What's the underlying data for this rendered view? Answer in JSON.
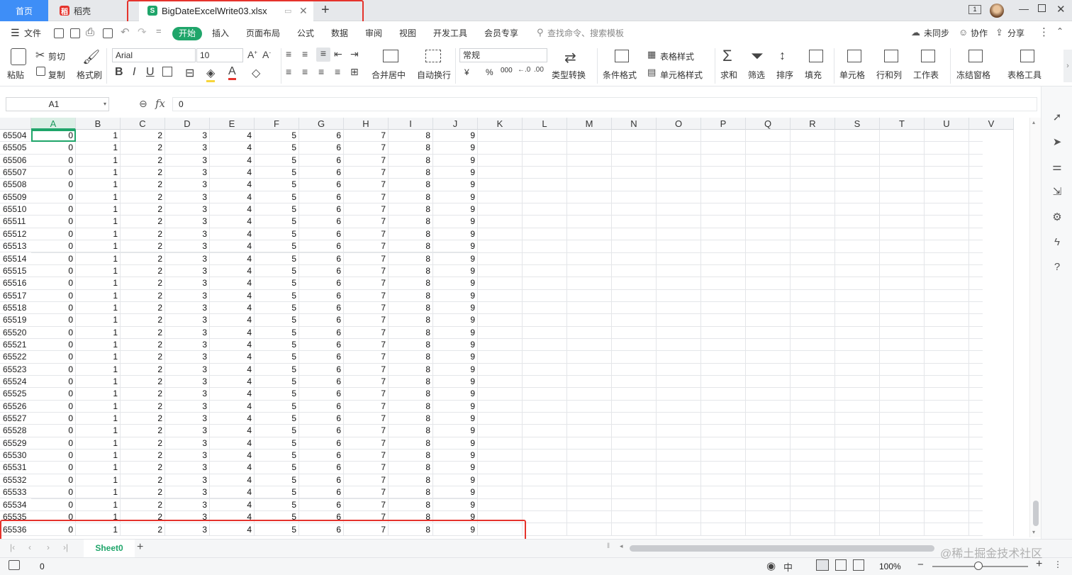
{
  "tabs": {
    "home": "首页",
    "daoke": "稻壳",
    "file": "BigDateExcelWrite03.xlsx",
    "file_icon": "S",
    "new_tab": "+"
  },
  "menu": {
    "file": "文件",
    "items": [
      "开始",
      "插入",
      "页面布局",
      "公式",
      "数据",
      "审阅",
      "视图",
      "开发工具",
      "会员专享"
    ],
    "active": "开始",
    "search_placeholder": "查找命令、搜索模板",
    "unsynced": "未同步",
    "collab": "协作",
    "share": "分享"
  },
  "ribbon": {
    "paste": "粘贴",
    "cut": "剪切",
    "copy": "复制",
    "format_painter": "格式刷",
    "font": "Arial",
    "font_size": "10",
    "merge_center": "合并居中",
    "wrap": "自动换行",
    "number_format": "常规",
    "type_convert": "类型转换",
    "cond_format": "条件格式",
    "table_style": "表格样式",
    "cell_style": "单元格样式",
    "sum": "求和",
    "filter": "筛选",
    "sort": "排序",
    "fill": "填充",
    "cell": "单元格",
    "row_col": "行和列",
    "worksheet": "工作表",
    "freeze": "冻结窗格",
    "table_tools": "表格工具",
    "currency": "¥",
    "percent": "%",
    "thousands": "000"
  },
  "formula_bar": {
    "name_box": "A1",
    "fx": "fx",
    "value": "0"
  },
  "grid": {
    "columns": [
      "A",
      "B",
      "C",
      "D",
      "E",
      "F",
      "G",
      "H",
      "I",
      "J",
      "K",
      "L",
      "M",
      "N",
      "O",
      "P",
      "Q",
      "R",
      "S",
      "T",
      "U",
      "V"
    ],
    "selected_column": "A",
    "row_numbers": [
      "65504",
      "65505",
      "65506",
      "65507",
      "65508",
      "65509",
      "65510",
      "65511",
      "65512",
      "65513",
      "65514",
      "65515",
      "65516",
      "65517",
      "65518",
      "65519",
      "65520",
      "65521",
      "65522",
      "65523",
      "65524",
      "65525",
      "65526",
      "65527",
      "65528",
      "65529",
      "65530",
      "65531",
      "65532",
      "65533",
      "65534",
      "65535"
    ],
    "row_values": [
      "0",
      "1",
      "2",
      "3",
      "4",
      "5",
      "6",
      "7",
      "8",
      "9"
    ],
    "last_row_number": "65536"
  },
  "sheets": {
    "active": "Sheet0",
    "add": "+"
  },
  "status": {
    "value": "0",
    "zoom": "100%",
    "watermark": "@稀土掘金技术社区"
  },
  "colors": {
    "accent": "#1fa56a",
    "home_tab": "#3e8ef7",
    "highlight_box": "#e5332c"
  }
}
